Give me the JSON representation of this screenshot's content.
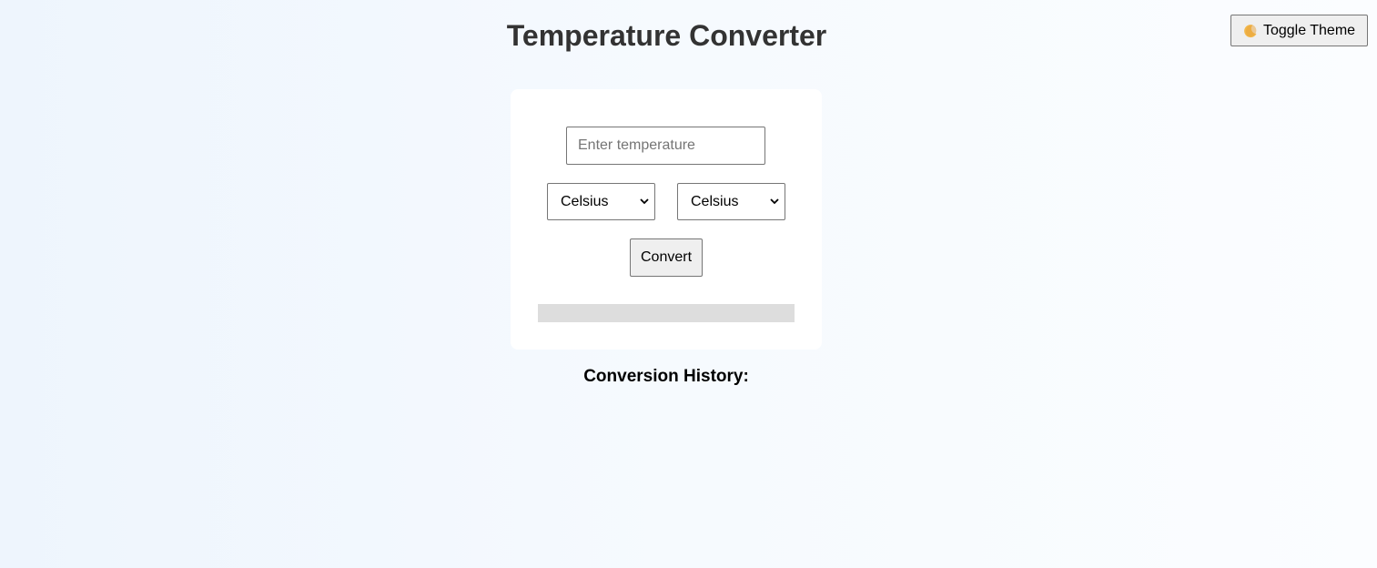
{
  "header": {
    "title": "Temperature Converter",
    "theme_toggle_label": "Toggle Theme",
    "theme_toggle_icon": "moon-icon"
  },
  "converter": {
    "input_value": "",
    "input_placeholder": "Enter temperature",
    "from_unit": "Celsius",
    "to_unit": "Celsius",
    "convert_label": "Convert",
    "result_text": ""
  },
  "history": {
    "title": "Conversion History:",
    "items": []
  },
  "colors": {
    "background_start": "#eef5fd",
    "background_end": "#fbfdff",
    "card": "#ffffff",
    "title_text": "#333333",
    "result_bar": "#dddddd",
    "button_bg": "#efefef",
    "control_border": "#767676"
  }
}
